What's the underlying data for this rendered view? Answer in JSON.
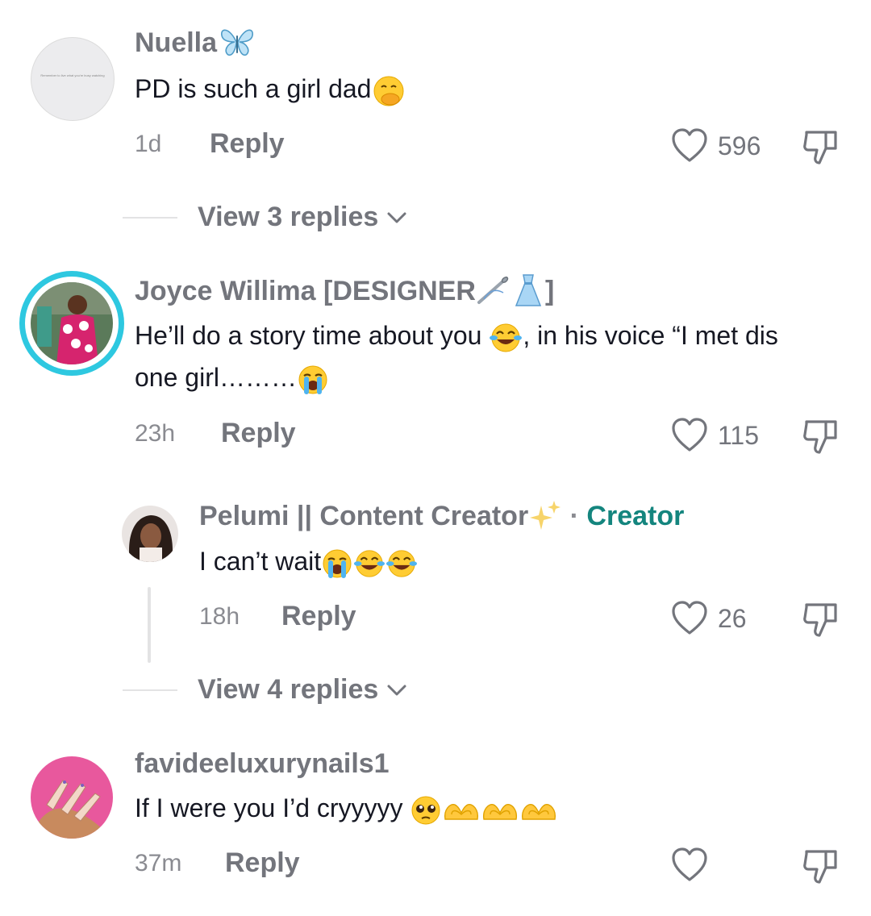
{
  "comments": [
    {
      "username": "Nuella",
      "text": "PD is such a girl dad",
      "time": "1d",
      "reply_label": "Reply",
      "likes": "596",
      "avatar_caption": "Remember to live what you're busy watching"
    },
    {
      "username": "Joyce Willima [DESIGNER",
      "username_suffix": "]",
      "text_line1": "He’ll do a story time about you",
      "text_line1b": ", in his voice “I met dis",
      "text_line2": "one girl………",
      "time": "23h",
      "reply_label": "Reply",
      "likes": "115"
    },
    {
      "username": "Pelumi || Content Creator",
      "creator_separator": "·",
      "creator_label": "Creator",
      "text": "I can’t wait",
      "time": "18h",
      "reply_label": "Reply",
      "likes": "26"
    },
    {
      "username": "favideeluxurynails1",
      "text": "If I were you I’d cryyyyy",
      "time": "37m",
      "reply_label": "Reply",
      "likes": ""
    }
  ],
  "view_replies": [
    {
      "label": "View 3 replies"
    },
    {
      "label": "View 4 replies"
    }
  ],
  "icons": {
    "like": "heart-outline-icon",
    "dislike": "thumbs-down-icon",
    "expand": "chevron-down-icon"
  },
  "colors": {
    "creator_accent": "#14857e",
    "story_ring": "#2ec8e0"
  }
}
